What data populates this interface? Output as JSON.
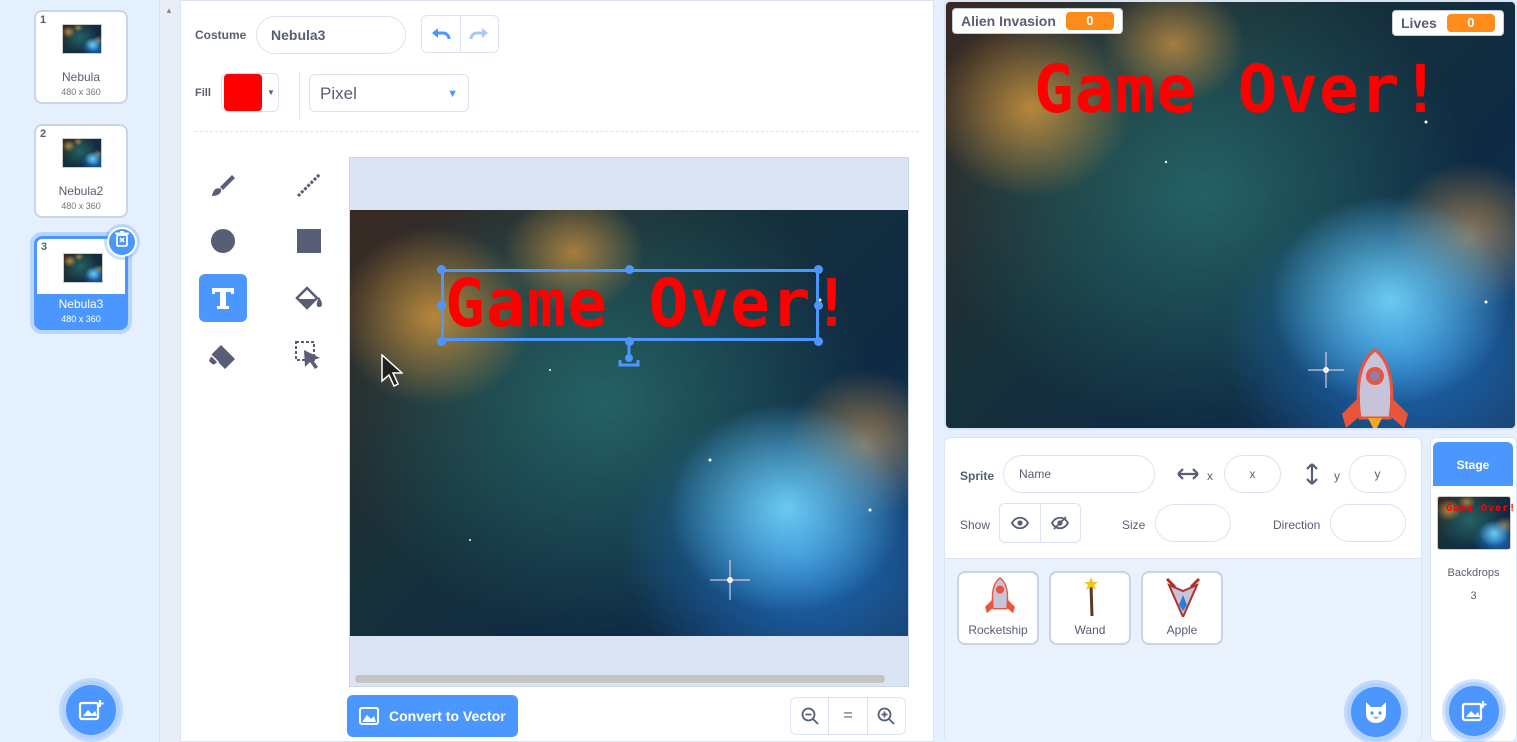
{
  "costumes": [
    {
      "number": "1",
      "name": "Nebula",
      "size": "480 x 360"
    },
    {
      "number": "2",
      "name": "Nebula2",
      "size": "480 x 360"
    },
    {
      "number": "3",
      "name": "Nebula3",
      "size": "480 x 360"
    }
  ],
  "editor": {
    "costume_label": "Costume",
    "costume_name": "Nebula3",
    "fill_label": "Fill",
    "fill_color": "#ff0000",
    "mode": "Pixel",
    "canvas_text": "Game Over!",
    "convert_button": "Convert to Vector",
    "zoom_reset": "="
  },
  "tools": [
    "brush-icon",
    "line-icon",
    "circle-icon",
    "rectangle-icon",
    "text-icon",
    "fill-icon",
    "eraser-icon",
    "select-icon"
  ],
  "stage": {
    "monitors": [
      {
        "label": "Alien Invasion",
        "value": "0"
      },
      {
        "label": "Lives",
        "value": "0"
      }
    ],
    "text": "Game Over!"
  },
  "sprite_info": {
    "sprite_label": "Sprite",
    "name_placeholder": "Name",
    "x_label": "x",
    "x_placeholder": "x",
    "y_label": "y",
    "y_placeholder": "y",
    "show_label": "Show",
    "size_label": "Size",
    "direction_label": "Direction"
  },
  "sprites": [
    {
      "name": "Rocketship"
    },
    {
      "name": "Wand"
    },
    {
      "name": "Apple"
    }
  ],
  "stage_selector": {
    "title": "Stage",
    "backdrops_label": "Backdrops",
    "backdrops_count": "3"
  },
  "colors": {
    "accent": "#4c97ff",
    "monitor_value": "#ff8c1a"
  }
}
